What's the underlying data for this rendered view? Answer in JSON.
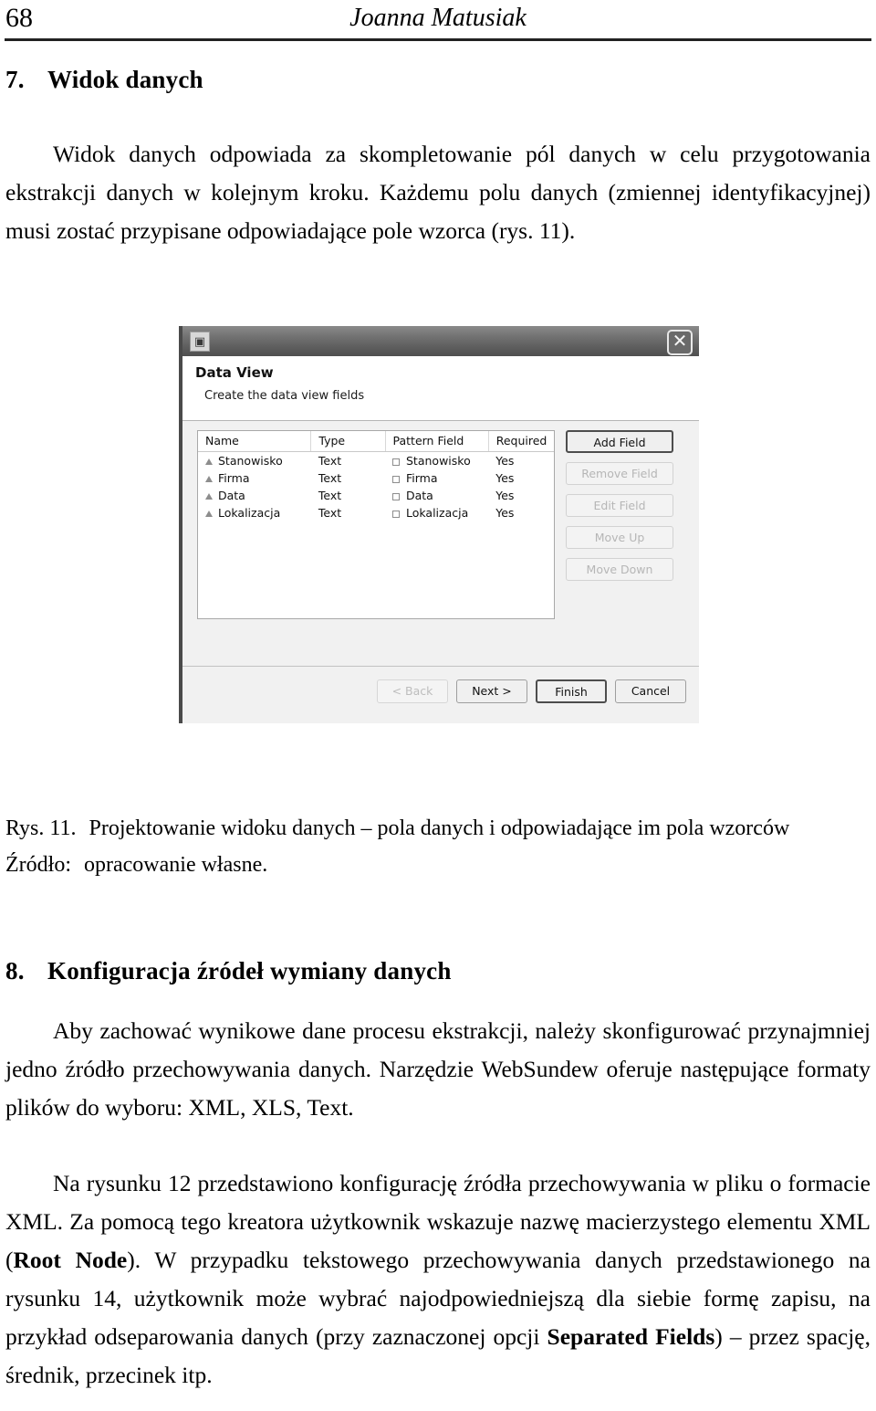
{
  "page": {
    "folio": "68",
    "running_title": "Joanna Matusiak"
  },
  "sections": {
    "seven": {
      "number": "7.",
      "title": "Widok danych"
    },
    "eight": {
      "number": "8.",
      "title": "Konfiguracja źródeł wymiany danych"
    }
  },
  "paragraphs": {
    "p1": "Widok danych odpowiada za skompletowanie pól danych w celu przygotowania ekstrakcji danych w kolejnym kroku. Każdemu polu danych (zmiennej identyfikacyjnej) musi zostać przypisane odpowiadające pole wzorca (rys. 11).",
    "p2": "Aby zachować wynikowe dane procesu ekstrakcji, należy skonfigurować przynajmniej jedno źródło przechowywania danych. Narzędzie WebSundew oferuje następujące formaty plików do wyboru: XML, XLS, Text.",
    "p3_a": "Na rysunku 12 przedstawiono konfigurację źródła przechowywania w pliku o formacie XML. Za pomocą tego kreatora użytkownik wskazuje nazwę macierzystego elementu XML (",
    "p3_b": "Root Node",
    "p3_c": "). W przypadku tekstowego przechowywania danych przedstawionego na rysunku 14, użytkownik może wybrać najodpowiedniejszą dla siebie formę zapisu, na przykład odseparowania danych (przy zaznaczonej opcji ",
    "p3_d": "Separated Fields",
    "p3_e": ") – przez spację, średnik, przecinek itp."
  },
  "figure": {
    "caption_label": "Rys. 11.",
    "caption_text": "Projektowanie widoku danych – pola danych i odpowiadające im pola wzorców",
    "source_label": "Źródło:",
    "source_text": "opracowanie własne."
  },
  "dialog": {
    "close_glyph": "✕",
    "icon_glyph": "▣",
    "header_title": "Data View",
    "header_subtitle": "Create the data view fields",
    "table": {
      "columns": [
        "Name",
        "Type",
        "Pattern Field",
        "Required"
      ],
      "rows": [
        {
          "name": "Stanowisko",
          "type": "Text",
          "pattern": "Stanowisko",
          "required": "Yes"
        },
        {
          "name": "Firma",
          "type": "Text",
          "pattern": "Firma",
          "required": "Yes"
        },
        {
          "name": "Data",
          "type": "Text",
          "pattern": "Data",
          "required": "Yes"
        },
        {
          "name": "Lokalizacja",
          "type": "Text",
          "pattern": "Lokalizacja",
          "required": "Yes"
        }
      ]
    },
    "side_buttons": [
      {
        "label": "Add Field",
        "state": "enabled"
      },
      {
        "label": "Remove Field",
        "state": "disabled"
      },
      {
        "label": "Edit Field",
        "state": "disabled"
      },
      {
        "label": "Move Up",
        "state": "disabled"
      },
      {
        "label": "Move Down",
        "state": "disabled"
      }
    ],
    "wizard_buttons": [
      {
        "label": "< Back",
        "state": "disabled"
      },
      {
        "label": "Next >",
        "state": "enabled"
      },
      {
        "label": "Finish",
        "state": "default"
      },
      {
        "label": "Cancel",
        "state": "enabled"
      }
    ]
  }
}
